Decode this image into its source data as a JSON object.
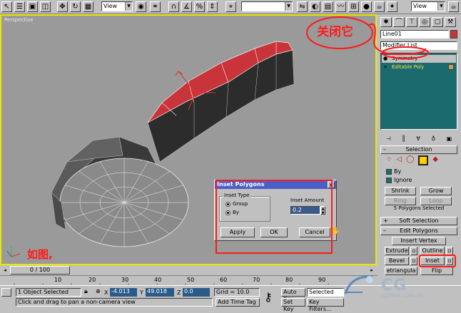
{
  "toolbar": {
    "view_combo_1": "View",
    "view_combo_2": "View",
    "selection_set_combo": ""
  },
  "viewport": {
    "label": "Perspective"
  },
  "annotations": {
    "close_it": "关闭它",
    "as_shown": "如图,"
  },
  "dialog": {
    "title": "Inset Polygons",
    "inset_type_label": "Inset Type",
    "group_label": "Group",
    "by_polygon_label": "By",
    "inset_amount_label": "Inset Amount",
    "inset_amount_value": "0.2",
    "apply": "Apply",
    "ok": "OK",
    "cancel": "Cancel"
  },
  "command_panel": {
    "object_name": "Line01",
    "modifier_list": "Modifier List",
    "stack": [
      "Symmetry",
      "Editable Poly"
    ],
    "selection_rollout": "Selection",
    "by_label": "By",
    "ignore_label": "Ignore",
    "shrink": "Shrink",
    "grow": "Grow",
    "ring": "Ring",
    "loop": "Loop",
    "selected_info": "5 Polygons Selected",
    "soft_selection_rollout": "Soft Selection",
    "edit_polygons_rollout": "Edit Polygons",
    "insert_vertex": "Insert Vertex",
    "extrude": "Extrude",
    "outline": "Outline",
    "bevel": "Bevel",
    "inset": "Inset",
    "retriangulate": "etriangula",
    "flip": "Flip"
  },
  "timeline": {
    "frame_display": "0 / 100",
    "ticks": [
      "10",
      "20",
      "30",
      "40",
      "50",
      "60",
      "70",
      "80",
      "90"
    ]
  },
  "status": {
    "selected_count": "1 Object Selected",
    "prompt": "Click and drag to pan a non-camera view",
    "x_label": "X",
    "x_value": "-4.013",
    "y_label": "Y",
    "y_value": "49.018",
    "z_label": "Z",
    "z_value": "0.0",
    "grid": "Grid = 10.0",
    "add_time_tag": "Add Time Tag",
    "auto_key": "Auto Key",
    "selected_combo": "Selected",
    "set_key": "Set Key",
    "key_filters": "Key Filters..."
  },
  "watermark": {
    "logo_text": "CG",
    "url": "cgtime.com.cn"
  }
}
